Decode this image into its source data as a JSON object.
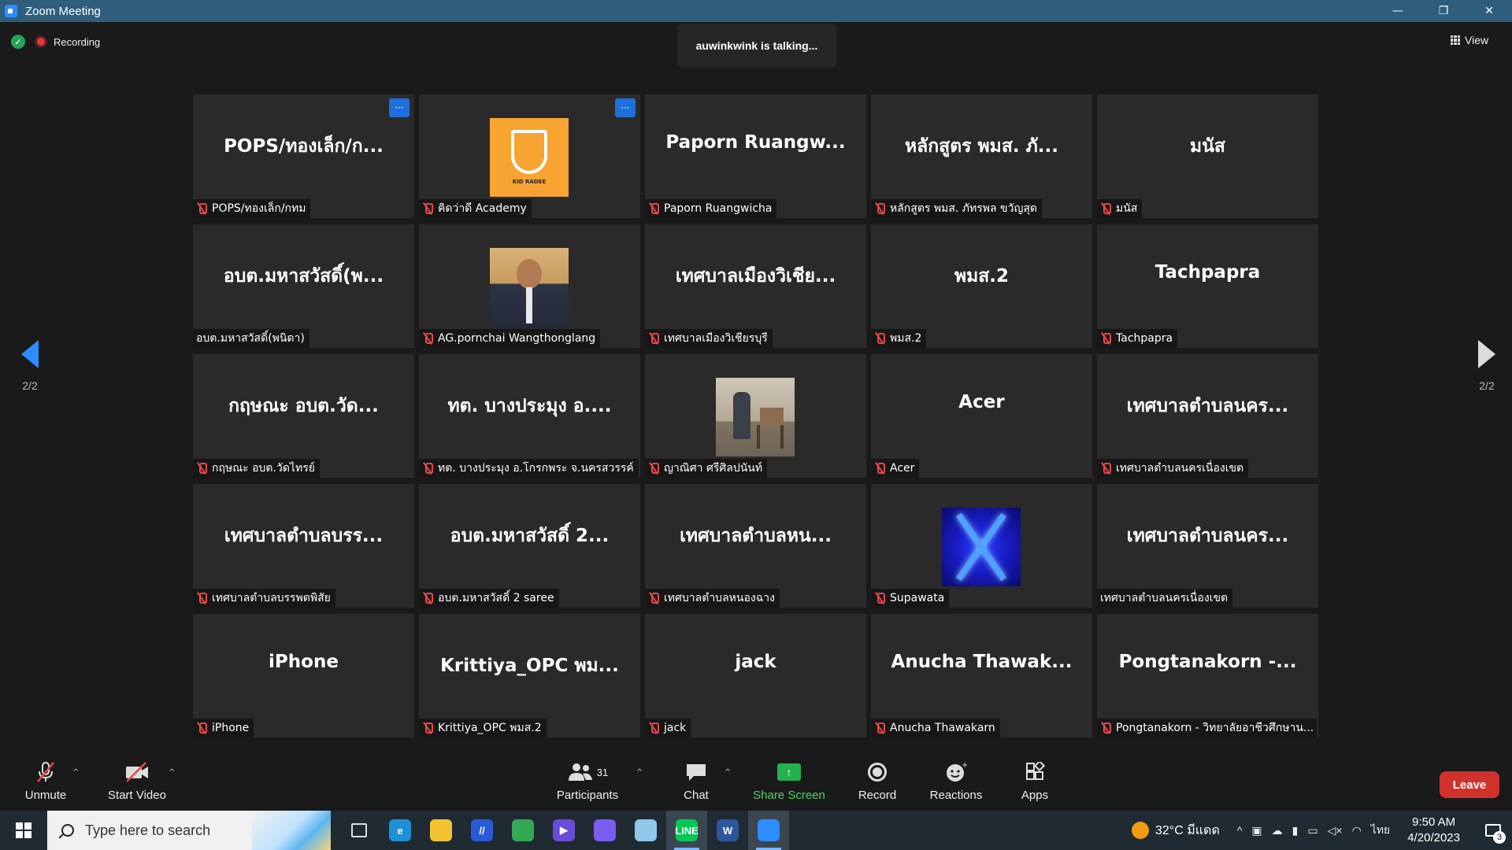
{
  "window": {
    "title": "Zoom Meeting"
  },
  "topbar": {
    "recording_label": "Recording",
    "talking": "auwinkwink is talking...",
    "view_label": "View"
  },
  "pager": {
    "left_label": "2/2",
    "right_label": "2/2"
  },
  "tiles": [
    {
      "display": "POPS/ทองเล็ก/ก...",
      "name": "POPS/ทองเล็ก/กทม",
      "muted": true,
      "more": true
    },
    {
      "display": "",
      "name": "คิดว่าดี Academy",
      "muted": true,
      "more": true,
      "avatar": "kidradee",
      "avatar_label": "KID RADEE"
    },
    {
      "display": "Paporn Ruangw...",
      "name": "Paporn Ruangwicha",
      "muted": true
    },
    {
      "display": "หลักสูตร พมส. ภั...",
      "name": "หลักสูตร พมส. ภัทรพล ขวัญสุด",
      "muted": true
    },
    {
      "display": "มนัส",
      "name": "มนัส",
      "muted": true
    },
    {
      "display": "อบต.มหาสวัสดิ์(พ...",
      "name": "อบต.มหาสวัสดิ์(พนิดา)",
      "muted": false
    },
    {
      "display": "",
      "name": "AG.pornchai  Wangthonglang",
      "muted": true,
      "avatar": "person"
    },
    {
      "display": "เทศบาลเมืองวิเชีย...",
      "name": "เทศบาลเมืองวิเชียรบุรี",
      "muted": true
    },
    {
      "display": "พมส.2",
      "name": "พมส.2",
      "muted": true
    },
    {
      "display": "Tachpapra",
      "name": "Tachpapra",
      "muted": true
    },
    {
      "display": "กฤษณะ  อบต.วัด...",
      "name": "กฤษณะ  อบต.วัดไทรย์",
      "muted": true
    },
    {
      "display": "ทต. บางประมุง อ....",
      "name": "ทต. บางประมุง อ.โกรกพระ จ.นครสวรรค์",
      "muted": true
    },
    {
      "display": "",
      "name": "ญาณิศา ศรีศิลปนันท์",
      "muted": true,
      "avatar": "room"
    },
    {
      "display": "Acer",
      "name": "Acer",
      "muted": true
    },
    {
      "display": "เทศบาลตำบลนคร...",
      "name": "เทศบาลตำบลนครเนื่องเขต",
      "muted": true
    },
    {
      "display": "เทศบาลตำบลบรร...",
      "name": "เทศบาลตำบลบรรพตพิสัย",
      "muted": true
    },
    {
      "display": "อบต.มหาสวัสดิ์ 2...",
      "name": "อบต.มหาสวัสดิ์ 2 saree",
      "muted": true
    },
    {
      "display": "เทศบาลตำบลหน...",
      "name": "เทศบาลตำบลหนองฉาง",
      "muted": true
    },
    {
      "display": "",
      "name": "Supawata",
      "muted": true,
      "avatar": "blue"
    },
    {
      "display": "เทศบาลตำบลนคร...",
      "name": "เทศบาลตำบลนครเนื่องเขต",
      "muted": false
    },
    {
      "display": "iPhone",
      "name": "iPhone",
      "muted": true
    },
    {
      "display": "Krittiya_OPC พม...",
      "name": "Krittiya_OPC พมส.2",
      "muted": true
    },
    {
      "display": "jack",
      "name": "jack",
      "muted": true
    },
    {
      "display": "Anucha  Thawak...",
      "name": "Anucha Thawakarn",
      "muted": true
    },
    {
      "display": "Pongtanakorn -...",
      "name": "Pongtanakorn - วิทยาลัยอาชีวศึกษาน...",
      "muted": true
    }
  ],
  "controls": {
    "unmute": "Unmute",
    "start_video": "Start Video",
    "participants": "Participants",
    "participants_count": "31",
    "chat": "Chat",
    "share_screen": "Share Screen",
    "record": "Record",
    "reactions": "Reactions",
    "apps": "Apps",
    "leave": "Leave",
    "share_color": "#22b14c",
    "leave_color": "#d0312d"
  },
  "taskbar": {
    "search_placeholder": "Type here to search",
    "weather": "32°C  มีแดด",
    "lang": "ไทย",
    "time": "9:50 AM",
    "date": "4/20/2023",
    "notif_count": "3",
    "apps": [
      {
        "name": "task-view-icon",
        "label": "",
        "color": "transparent"
      },
      {
        "name": "edge-icon",
        "label": "e",
        "color": "#1f8fd6"
      },
      {
        "name": "file-explorer-icon",
        "label": "",
        "color": "#f4c430"
      },
      {
        "name": "vectorize-icon",
        "label": "//",
        "color": "#2a5bd7"
      },
      {
        "name": "chrome-icon",
        "label": "",
        "color": "#34a853"
      },
      {
        "name": "media-player-icon",
        "label": "▶",
        "color": "#6a4cd6"
      },
      {
        "name": "messenger-icon",
        "label": "",
        "color": "#7a5cf0"
      },
      {
        "name": "notepad-icon",
        "label": "",
        "color": "#8fc8e8"
      },
      {
        "name": "line-icon",
        "label": "LINE",
        "color": "#06c755"
      },
      {
        "name": "word-icon",
        "label": "W",
        "color": "#2b579a"
      },
      {
        "name": "zoom-icon",
        "label": "",
        "color": "#2d8cff"
      }
    ]
  }
}
